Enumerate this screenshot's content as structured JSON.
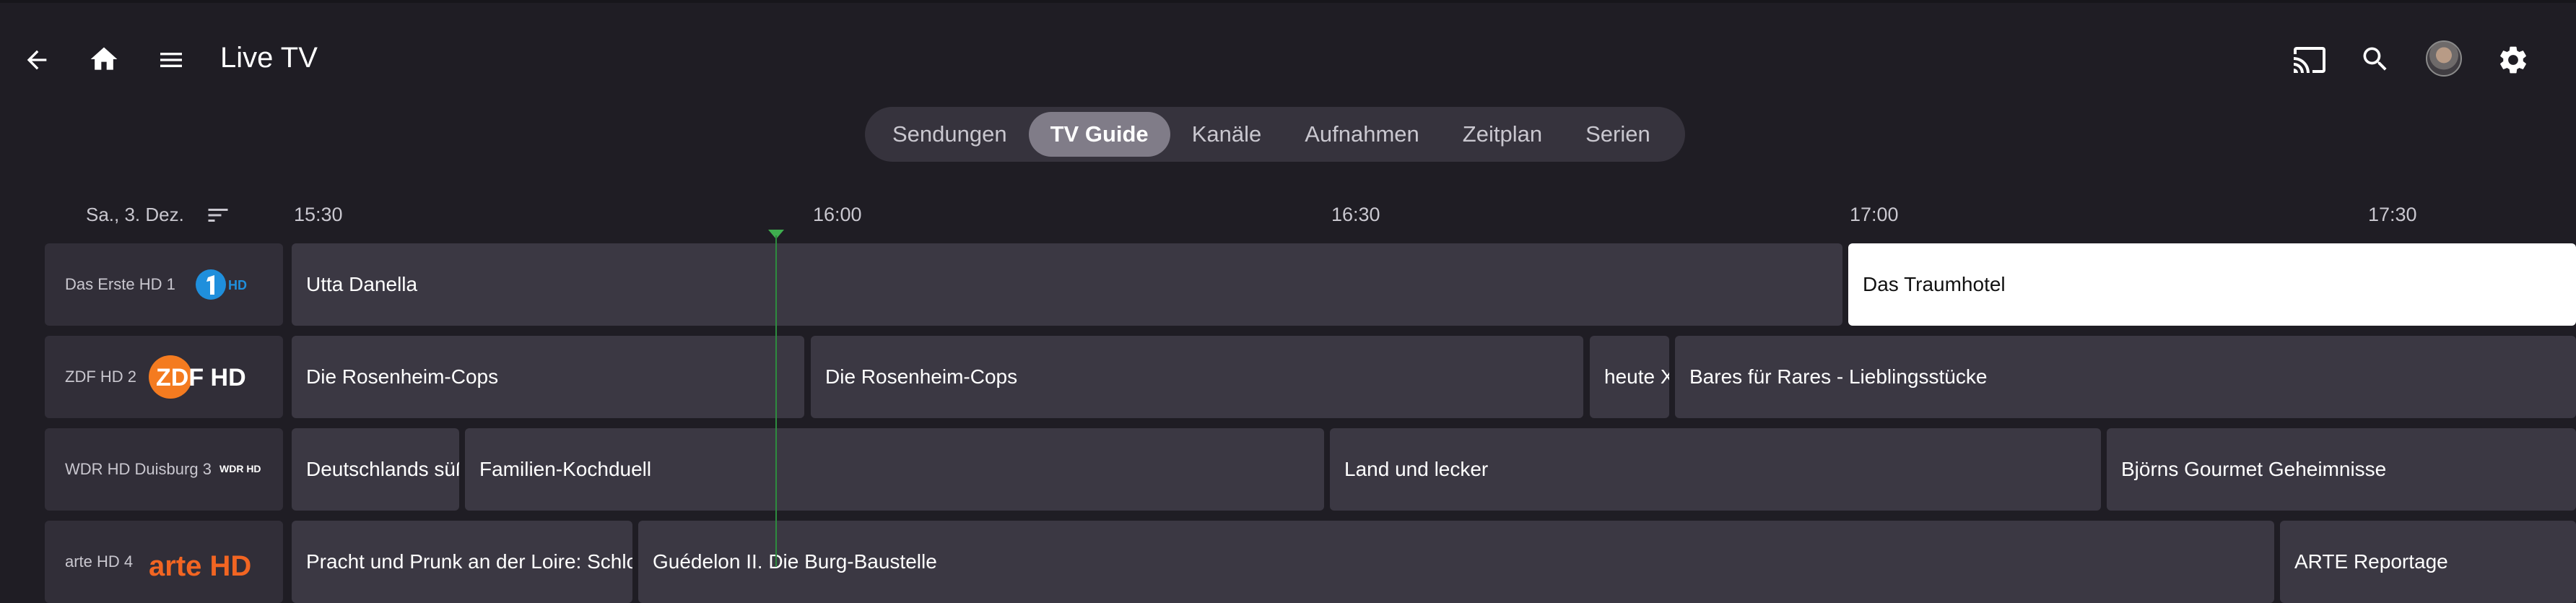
{
  "header": {
    "title": "Live TV",
    "icons": [
      "back-arrow-icon",
      "home-icon",
      "hamburger-menu-icon",
      "cast-icon",
      "search-icon",
      "avatar",
      "settings-gear-icon"
    ]
  },
  "tabs": [
    {
      "label": "Sendungen",
      "active": false
    },
    {
      "label": "TV Guide",
      "active": true
    },
    {
      "label": "Kanäle",
      "active": false
    },
    {
      "label": "Aufnahmen",
      "active": false
    },
    {
      "label": "Zeitplan",
      "active": false
    },
    {
      "label": "Serien",
      "active": false
    }
  ],
  "guide": {
    "date": "Sa., 3. Dez.",
    "times": [
      "15:30",
      "16:00",
      "16:30",
      "17:00",
      "17:30"
    ],
    "channels": [
      {
        "name": "Das Erste HD 1",
        "logo_text": "HD",
        "programs": [
          {
            "title": "Utta Danella"
          },
          {
            "title": "Das Traumhotel",
            "highlighted": true
          }
        ]
      },
      {
        "name": "ZDF HD 2",
        "logo_text": "ZDF HD",
        "programs": [
          {
            "title": "Die Rosenheim-Cops"
          },
          {
            "title": "Die Rosenheim-Cops"
          },
          {
            "title": "heute Xpress"
          },
          {
            "title": "Bares für Rares - Lieblingsstücke"
          }
        ]
      },
      {
        "name": "WDR HD Duisburg 3",
        "logo_text": "WDR HD",
        "programs": [
          {
            "title": "Deutschlands süße Seiten"
          },
          {
            "title": "Familien-Kochduell"
          },
          {
            "title": "Land und lecker"
          },
          {
            "title": "Björns Gourmet Geheimnisse"
          }
        ]
      },
      {
        "name": "arte HD 4",
        "logo_text": "arte HD",
        "programs": [
          {
            "title": "Pracht und Prunk an der Loire: Schlo"
          },
          {
            "title": "Guédelon II. Die Burg-Baustelle"
          },
          {
            "title": "ARTE Reportage"
          }
        ]
      }
    ]
  },
  "colors": {
    "background": "#1f1d24",
    "cell": "#3b3843",
    "channel_cell": "#312e38",
    "active_tab": "#807c88",
    "now_indicator": "#3fae4f",
    "highlight": "#ffffff"
  }
}
